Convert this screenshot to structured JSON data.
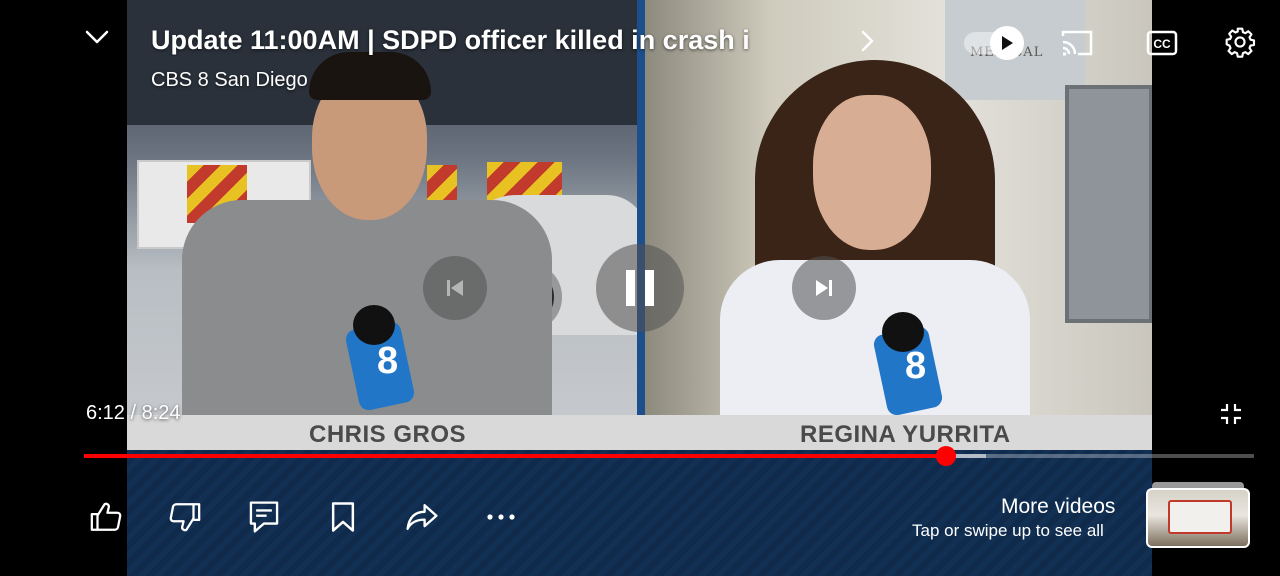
{
  "player": {
    "title": "Update 11:00AM | SDPD officer killed in crash i",
    "channel": "CBS 8 San Diego",
    "time_display": "6:12 / 8:24",
    "progress_fraction": 0.737,
    "buffer_fraction": 0.771,
    "playing": true,
    "autoplay_on": true
  },
  "video_content": {
    "left_reporter": "CHRIS GROS",
    "right_reporter": "REGINA YURRITA",
    "building_sign": "MEDICAL",
    "mic_logo": "8"
  },
  "more_videos": {
    "title": "More videos",
    "subtitle": "Tap or swipe up to see all"
  },
  "icons": {
    "collapse": "chevron-down-icon",
    "next_arrow": "chevron-right-icon",
    "cast": "cast-icon",
    "captions": "closed-captions-icon",
    "settings": "gear-icon",
    "previous": "skip-previous-icon",
    "pause": "pause-icon",
    "next": "skip-next-icon",
    "exit_fullscreen": "exit-fullscreen-icon",
    "like": "thumbs-up-icon",
    "dislike": "thumbs-down-icon",
    "comments": "comment-icon",
    "save": "bookmark-icon",
    "share": "share-icon",
    "more": "more-horizontal-icon"
  },
  "colors": {
    "progress": "#ff0000",
    "accent_band": "#123054"
  }
}
